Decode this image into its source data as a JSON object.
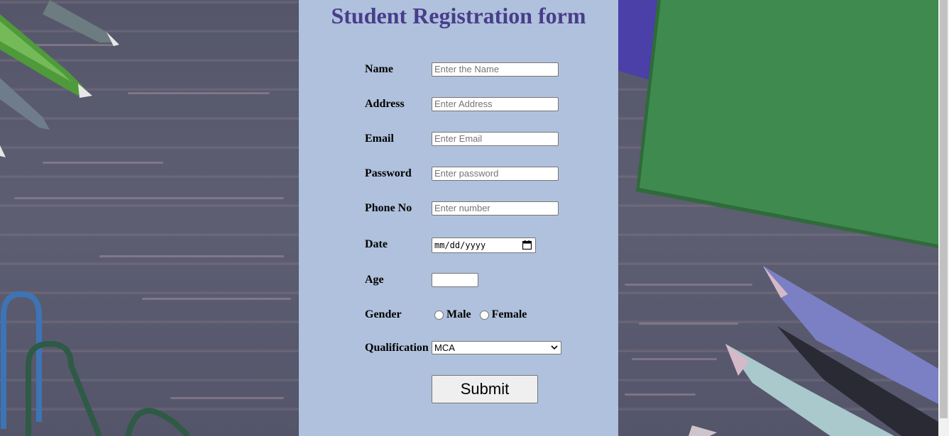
{
  "form": {
    "title": "Student Registration form",
    "fields": {
      "name": {
        "label": "Name",
        "placeholder": "Enter the Name"
      },
      "address": {
        "label": "Address",
        "placeholder": "Enter Address"
      },
      "email": {
        "label": "Email",
        "placeholder": "Enter Email"
      },
      "password": {
        "label": "Password",
        "placeholder": "Enter password"
      },
      "phone": {
        "label": "Phone No",
        "placeholder": "Enter number"
      },
      "date": {
        "label": "Date",
        "placeholder": "mm/dd/yyyy"
      },
      "age": {
        "label": "Age",
        "value": ""
      },
      "gender": {
        "label": "Gender",
        "options": [
          "Male",
          "Female"
        ]
      },
      "qualification": {
        "label": "Qualification",
        "selected": "MCA"
      }
    },
    "submit_label": "Submit"
  },
  "colors": {
    "panel": "#afc1dc",
    "title": "#483d8b"
  },
  "icons": [
    "calendar-icon",
    "chevron-down-icon"
  ]
}
